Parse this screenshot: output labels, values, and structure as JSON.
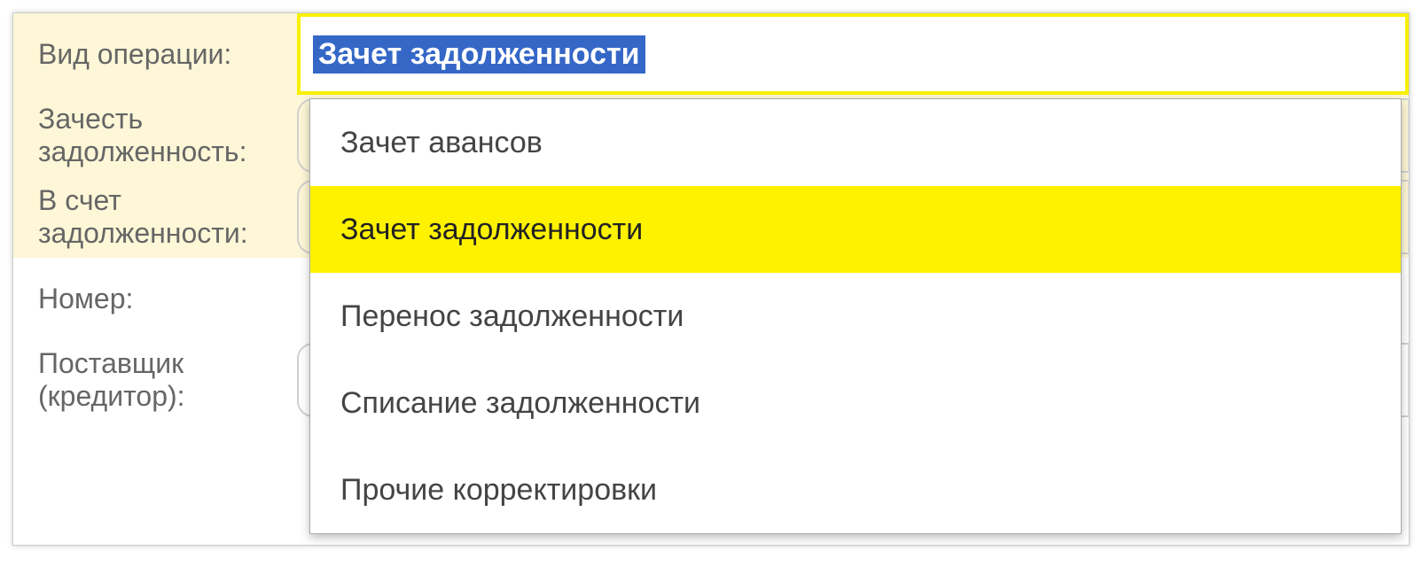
{
  "form": {
    "operation_type": {
      "label": "Вид операции:",
      "value": "Зачет задолженности"
    },
    "credit_debt": {
      "label": "Зачесть задолженность:"
    },
    "against_debt": {
      "label": "В счет задолженности:"
    },
    "number": {
      "label": "Номер:"
    },
    "supplier": {
      "label": "Поставщик (кредитор):"
    }
  },
  "dropdown": {
    "items": [
      {
        "label": "Зачет авансов",
        "selected": false
      },
      {
        "label": "Зачет задолженности",
        "selected": true
      },
      {
        "label": "Перенос задолженности",
        "selected": false
      },
      {
        "label": "Списание задолженности",
        "selected": false
      },
      {
        "label": "Прочие корректировки",
        "selected": false
      }
    ]
  }
}
